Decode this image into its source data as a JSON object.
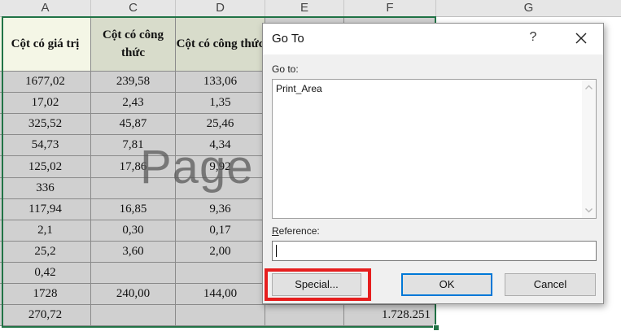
{
  "columns": [
    "A",
    "C",
    "D",
    "E",
    "F",
    "G"
  ],
  "header_row": {
    "a": "Cột có giá trị",
    "c": "Cột có công thức",
    "d": "Cột có công thức"
  },
  "rows": [
    {
      "a": "1677,02",
      "c": "239,58",
      "d": "133,06",
      "f": ""
    },
    {
      "a": "17,02",
      "c": "2,43",
      "d": "1,35",
      "f": ""
    },
    {
      "a": "325,52",
      "c": "45,87",
      "d": "25,46",
      "f": ""
    },
    {
      "a": "54,73",
      "c": "7,81",
      "d": "4,34",
      "f": ""
    },
    {
      "a": "125,02",
      "c": "17,86",
      "d": "9,92",
      "f": ""
    },
    {
      "a": "336",
      "c": "",
      "d": "",
      "f": ""
    },
    {
      "a": "117,94",
      "c": "16,85",
      "d": "9,36",
      "f": ""
    },
    {
      "a": "2,1",
      "c": "0,30",
      "d": "0,17",
      "f": ""
    },
    {
      "a": "25,2",
      "c": "3,60",
      "d": "2,00",
      "f": ""
    },
    {
      "a": "0,42",
      "c": "",
      "d": "",
      "f": ""
    },
    {
      "a": "1728",
      "c": "240,00",
      "d": "144,00",
      "f": ""
    },
    {
      "a": "270,72",
      "c": "",
      "d": "",
      "f": "1.728.251"
    }
  ],
  "watermark": "Page",
  "dialog": {
    "title": "Go To",
    "help": "?",
    "goto_label": "Go to:",
    "goto_items": [
      "Print_Area"
    ],
    "reference_label": "Reference:",
    "reference_value": "",
    "special_button": "Special...",
    "ok_button": "OK",
    "cancel_button": "Cancel"
  },
  "colors": {
    "selection": "#217346",
    "highlight": "#e61e1e",
    "ok_focus": "#0078d7"
  }
}
